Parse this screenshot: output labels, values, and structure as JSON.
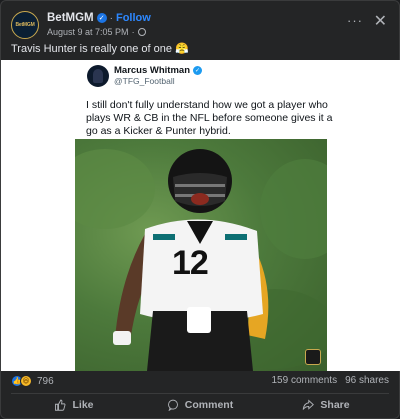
{
  "post": {
    "page_name": "BetMGM",
    "avatar_text": "BetMGM",
    "follow_label": "Follow",
    "timestamp": "August 9 at 7:05 PM",
    "caption": "Travis Hunter is really one of one 😤"
  },
  "tweet": {
    "author_name": "Marcus Whitman",
    "author_handle": "@TFG_Football",
    "text": "I still don't fully understand how we got a player who plays WR & CB in the NFL before someone gives it a go as a Kicker & Punter hybrid."
  },
  "photo": {
    "jersey_number": "12",
    "subject": "football player in white jersey #12 celebrating"
  },
  "engagement": {
    "reaction_count": "796",
    "comments": "159 comments",
    "shares": "96 shares"
  },
  "actions": {
    "like": "Like",
    "comment": "Comment",
    "share": "Share"
  },
  "colors": {
    "background": "#242526",
    "accent": "#2d88ff",
    "text_secondary": "#b0b3b8"
  }
}
